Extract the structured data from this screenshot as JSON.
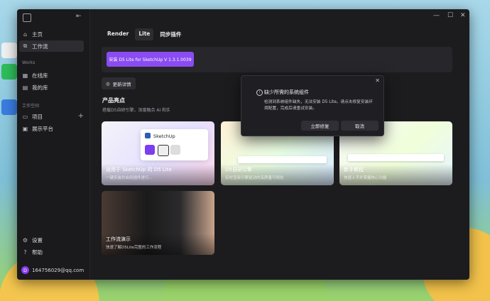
{
  "sidebar": {
    "items_top": [
      {
        "label": "主页",
        "icon": "home-icon"
      },
      {
        "label": "工作流",
        "icon": "workflow-icon"
      }
    ],
    "works_label": "Works",
    "works_items": [
      {
        "label": "在线库",
        "icon": "library-icon"
      },
      {
        "label": "我的库",
        "icon": "my-library-icon"
      }
    ],
    "workspace_label": "工作空间",
    "workspace_items": [
      {
        "label": "项目",
        "icon": "folder-icon"
      },
      {
        "label": "展示平台",
        "icon": "showcase-icon"
      }
    ],
    "bottom_items": [
      {
        "label": "设置",
        "icon": "settings-icon"
      },
      {
        "label": "帮助",
        "icon": "help-icon"
      }
    ],
    "user": {
      "avatar_letter": "D",
      "email": "164756029@qq.com"
    }
  },
  "main": {
    "tabs": [
      {
        "label": "Render",
        "active": false
      },
      {
        "label": "Lite",
        "active": true
      },
      {
        "label": "同步插件",
        "active": false
      }
    ],
    "install_button": "安装 D5 Lite for SketchUp V 1.3.1.0039",
    "update_button": "更新详情",
    "section_title": "产品亮点",
    "section_subtitle": "搭载D5自研引擎，深度融合 AI 和实",
    "cards": [
      {
        "title": "适用于 SketchUp 的 D5 Lite",
        "desc": "一键安装并启用插件进行...",
        "popup_title": "SketchUp"
      },
      {
        "title": "D5自研引擎",
        "desc": "实时渲染引擎驱动的高质量可视化"
      },
      {
        "title": "新手教程",
        "desc": "快速上手并掌握核心功能"
      },
      {
        "title": "工作流演示",
        "desc": "快速了解D5Lite完整的工作流程"
      }
    ]
  },
  "dialog": {
    "title": "缺少所需的系统组件",
    "message": "检测到系统组件缺失，无法安装 D5 Lite。请点击修复安装环境配置，完成后请重试安装。",
    "confirm": "立即修复",
    "cancel": "取消"
  },
  "colors": {
    "accent": "#8a4cf2",
    "window_bg": "#1c1c1f"
  }
}
